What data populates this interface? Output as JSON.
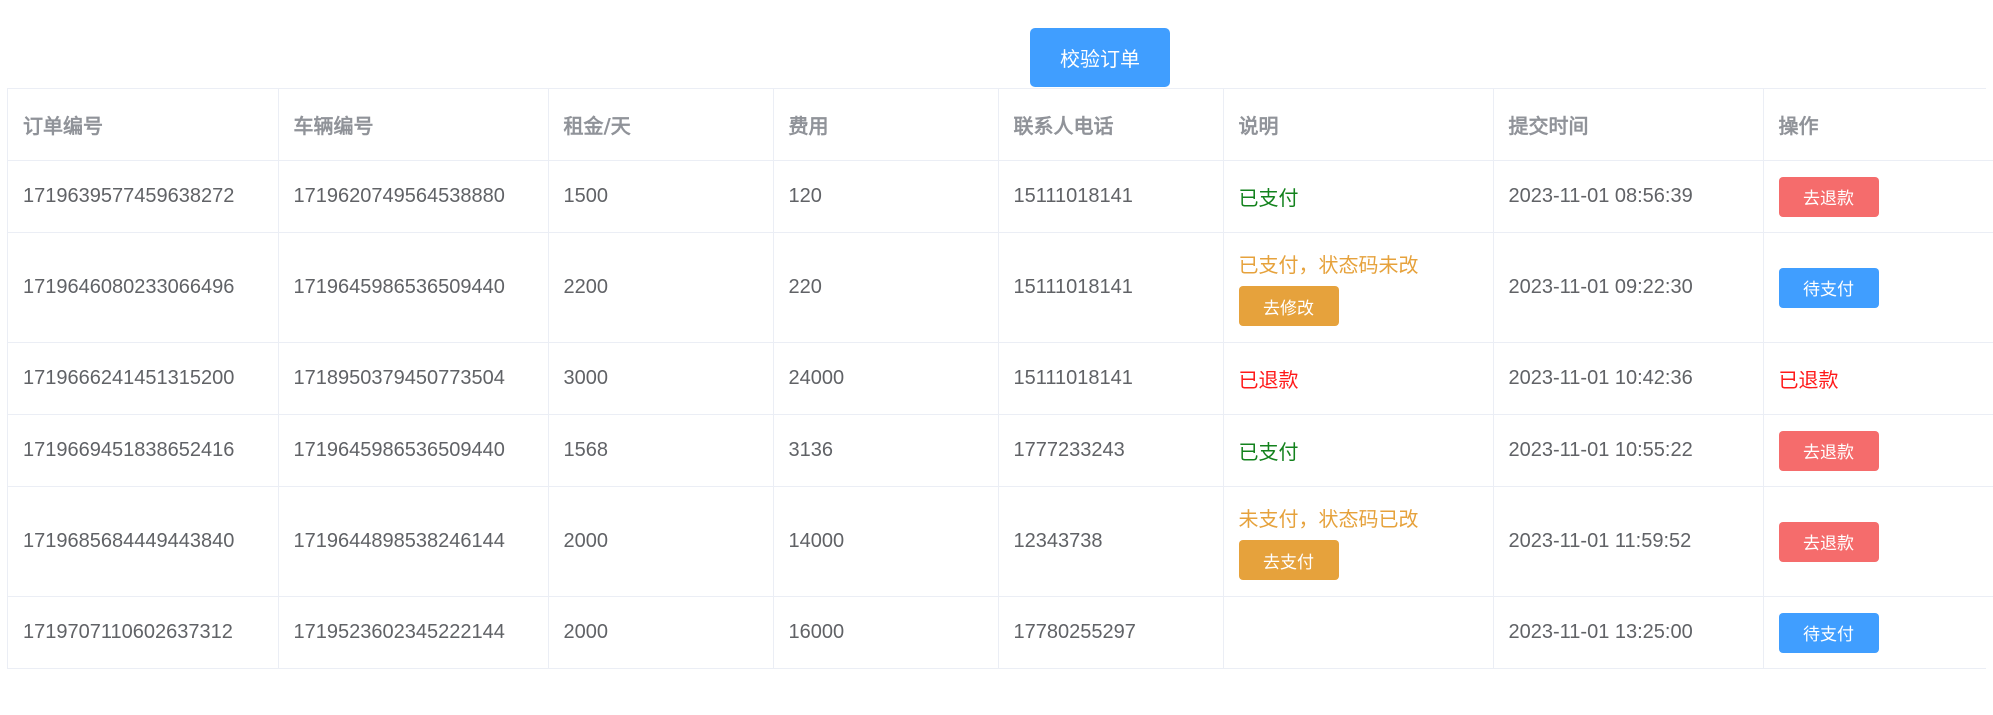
{
  "toolbar": {
    "verify_label": "校验订单"
  },
  "table": {
    "headers": [
      "订单编号",
      "车辆编号",
      "租金/天",
      "费用",
      "联系人电话",
      "说明",
      "提交时间",
      "操作"
    ],
    "rows": [
      {
        "order_id": "1719639577459638272",
        "vehicle_id": "1719620749564538880",
        "rent": "1500",
        "fee": "120",
        "phone": "15111018141",
        "desc": "已支付",
        "desc_status": "ok",
        "desc_button": "",
        "time": "2023-11-01 08:56:39",
        "action": "去退款",
        "action_type": "refund"
      },
      {
        "order_id": "1719646080233066496",
        "vehicle_id": "1719645986536509440",
        "rent": "2200",
        "fee": "220",
        "phone": "15111018141",
        "desc": "已支付，状态码未改",
        "desc_status": "warn",
        "desc_button": "去修改",
        "time": "2023-11-01 09:22:30",
        "action": "待支付",
        "action_type": "pay"
      },
      {
        "order_id": "1719666241451315200",
        "vehicle_id": "1718950379450773504",
        "rent": "3000",
        "fee": "24000",
        "phone": "15111018141",
        "desc": "已退款",
        "desc_status": "danger",
        "desc_button": "",
        "time": "2023-11-01 10:42:36",
        "action": "已退款",
        "action_type": "text"
      },
      {
        "order_id": "1719669451838652416",
        "vehicle_id": "1719645986536509440",
        "rent": "1568",
        "fee": "3136",
        "phone": "1777233243",
        "desc": "已支付",
        "desc_status": "ok",
        "desc_button": "",
        "time": "2023-11-01 10:55:22",
        "action": "去退款",
        "action_type": "refund"
      },
      {
        "order_id": "1719685684449443840",
        "vehicle_id": "1719644898538246144",
        "rent": "2000",
        "fee": "14000",
        "phone": "12343738",
        "desc": "未支付，状态码已改",
        "desc_status": "warn",
        "desc_button": "去支付",
        "time": "2023-11-01 11:59:52",
        "action": "去退款",
        "action_type": "refund"
      },
      {
        "order_id": "1719707110602637312",
        "vehicle_id": "1719523602345222144",
        "rent": "2000",
        "fee": "16000",
        "phone": "17780255297",
        "desc": "",
        "desc_status": "",
        "desc_button": "",
        "time": "2023-11-01 13:25:00",
        "action": "待支付",
        "action_type": "pay"
      }
    ]
  },
  "colors": {
    "primary": "#409eff",
    "danger_button": "#f56c6c",
    "warning": "#e6a23c",
    "success_text": "#13821d",
    "danger_text": "#ff1a1a"
  }
}
